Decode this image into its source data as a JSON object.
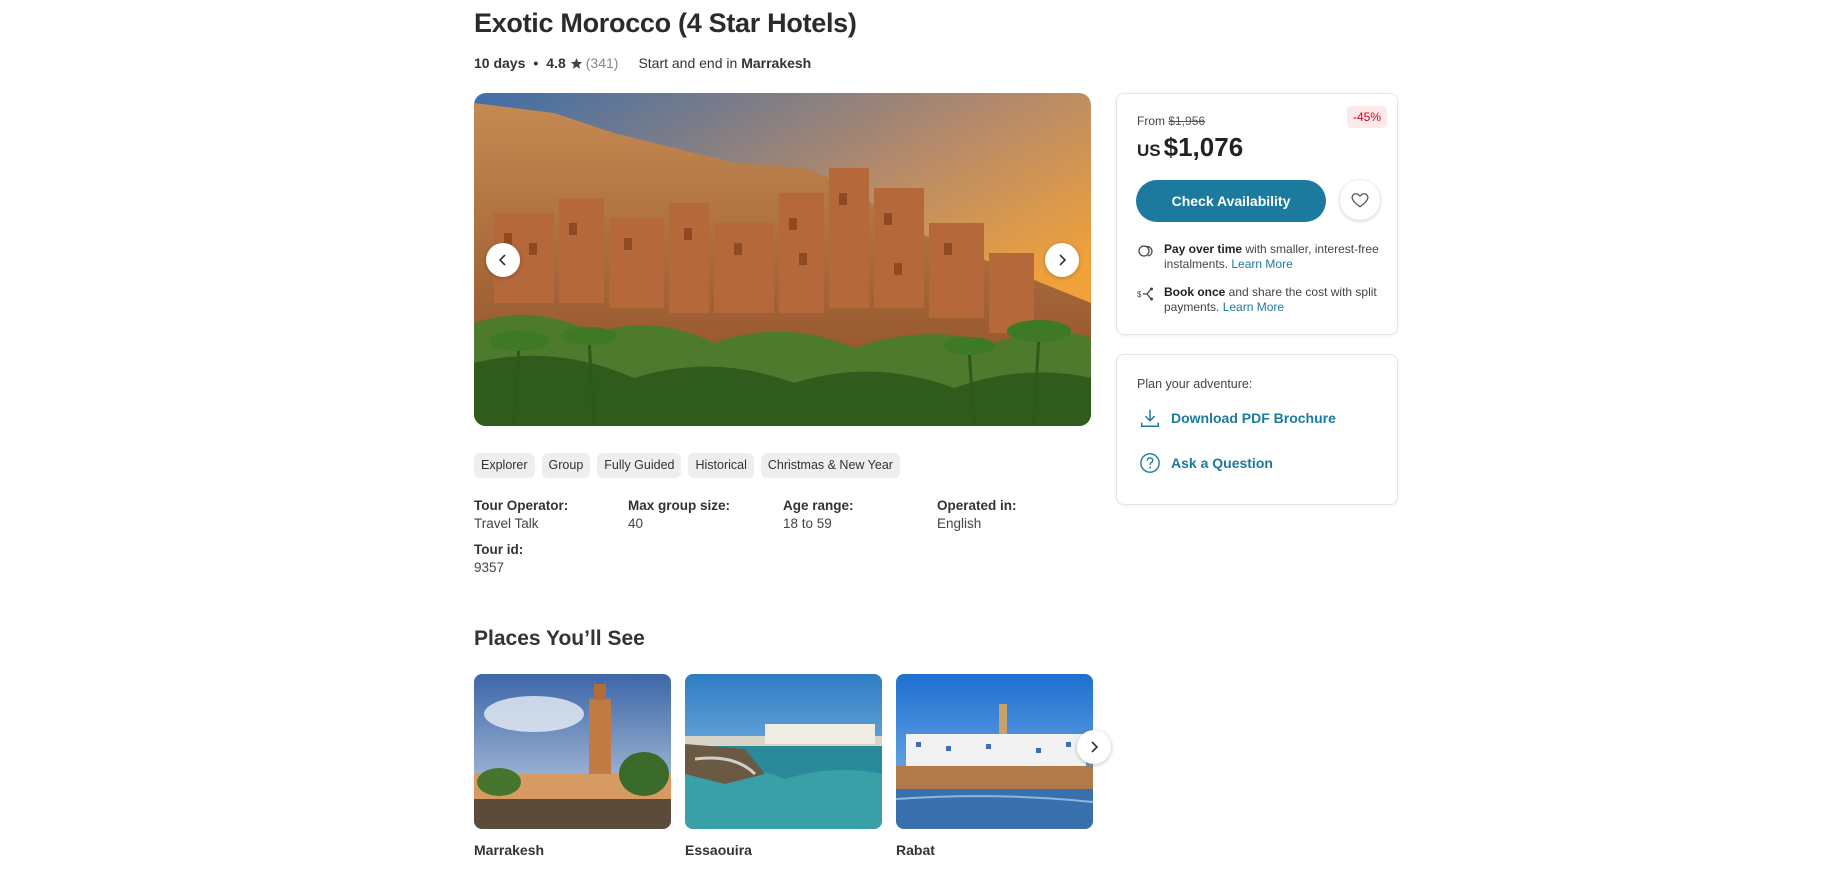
{
  "tour": {
    "title": "Exotic Morocco (4 Star Hotels)",
    "duration": "10 days",
    "rating": "4.8",
    "review_count": "(341)",
    "start_end_prefix": "Start and end in",
    "start_end_city": "Marrakesh"
  },
  "tags": [
    "Explorer",
    "Group",
    "Fully Guided",
    "Historical",
    "Christmas & New Year"
  ],
  "facts": {
    "operator_label": "Tour Operator:",
    "operator_value": "Travel Talk",
    "group_label": "Max group size:",
    "group_value": "40",
    "age_label": "Age range:",
    "age_value": "18 to 59",
    "operated_label": "Operated in:",
    "operated_value": "English",
    "id_label": "Tour id:",
    "id_value": "9357"
  },
  "places": {
    "title": "Places You’ll See",
    "items": [
      "Marrakesh",
      "Essaouira",
      "Rabat"
    ]
  },
  "pricing": {
    "from_label": "From",
    "original_price": "$1,956",
    "discount": "-45%",
    "currency": "US",
    "price": "$1,076",
    "check_button": "Check Availability",
    "perk1_bold": "Pay over time",
    "perk1_text": " with smaller, interest-free instalments.",
    "perk1_link": "Learn More",
    "perk2_bold": "Book once",
    "perk2_text": " and share the cost with split payments.",
    "perk2_link": "Learn More"
  },
  "plan": {
    "label": "Plan your adventure:",
    "download": "Download PDF Brochure",
    "ask": "Ask a Question"
  },
  "colors": {
    "accent": "#1b7a9e",
    "discount_text": "#d0021b",
    "discount_bg": "#fde8ea"
  },
  "icons": [
    "star-icon",
    "chevron-left-icon",
    "chevron-right-icon",
    "heart-icon",
    "coins-icon",
    "split-payment-icon",
    "download-icon",
    "question-icon"
  ]
}
